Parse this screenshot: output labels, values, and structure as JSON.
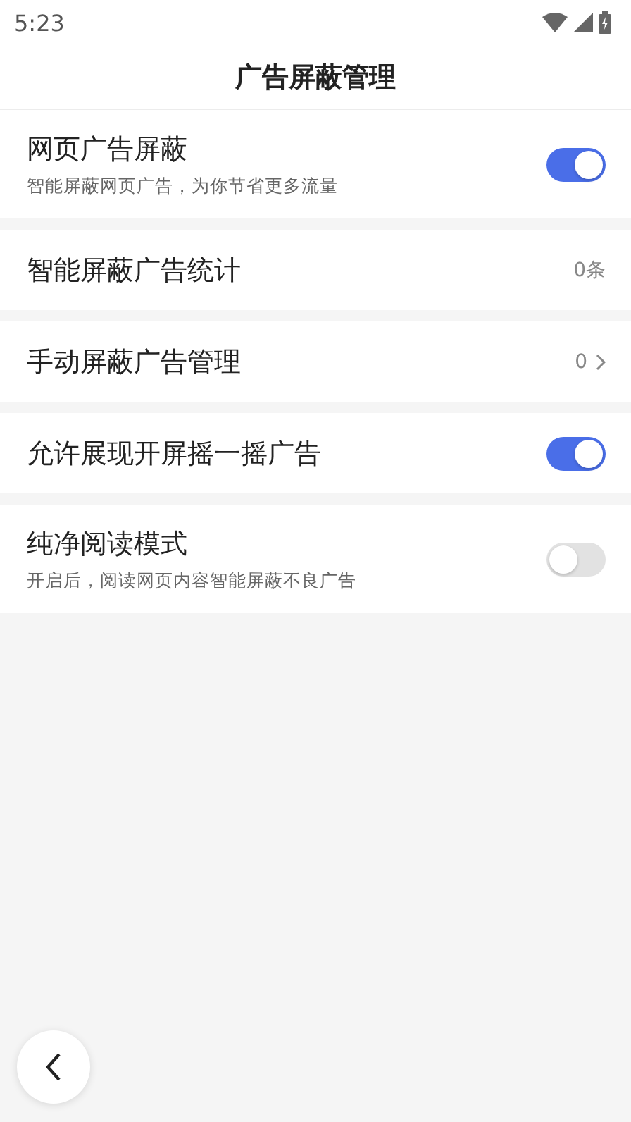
{
  "status_bar": {
    "time": "5:23"
  },
  "header": {
    "title": "广告屏蔽管理"
  },
  "settings": [
    {
      "kind": "toggle",
      "title": "网页广告屏蔽",
      "subtitle": "智能屏蔽网页广告，为你节省更多流量",
      "on": true
    },
    {
      "kind": "value",
      "title": "智能屏蔽广告统计",
      "value": "0条"
    },
    {
      "kind": "link",
      "title": "手动屏蔽广告管理",
      "value": "0"
    },
    {
      "kind": "toggle",
      "title": "允许展现开屏摇一摇广告",
      "on": true
    },
    {
      "kind": "toggle",
      "title": "纯净阅读模式",
      "subtitle": "开启后，阅读网页内容智能屏蔽不良广告",
      "on": false
    }
  ]
}
